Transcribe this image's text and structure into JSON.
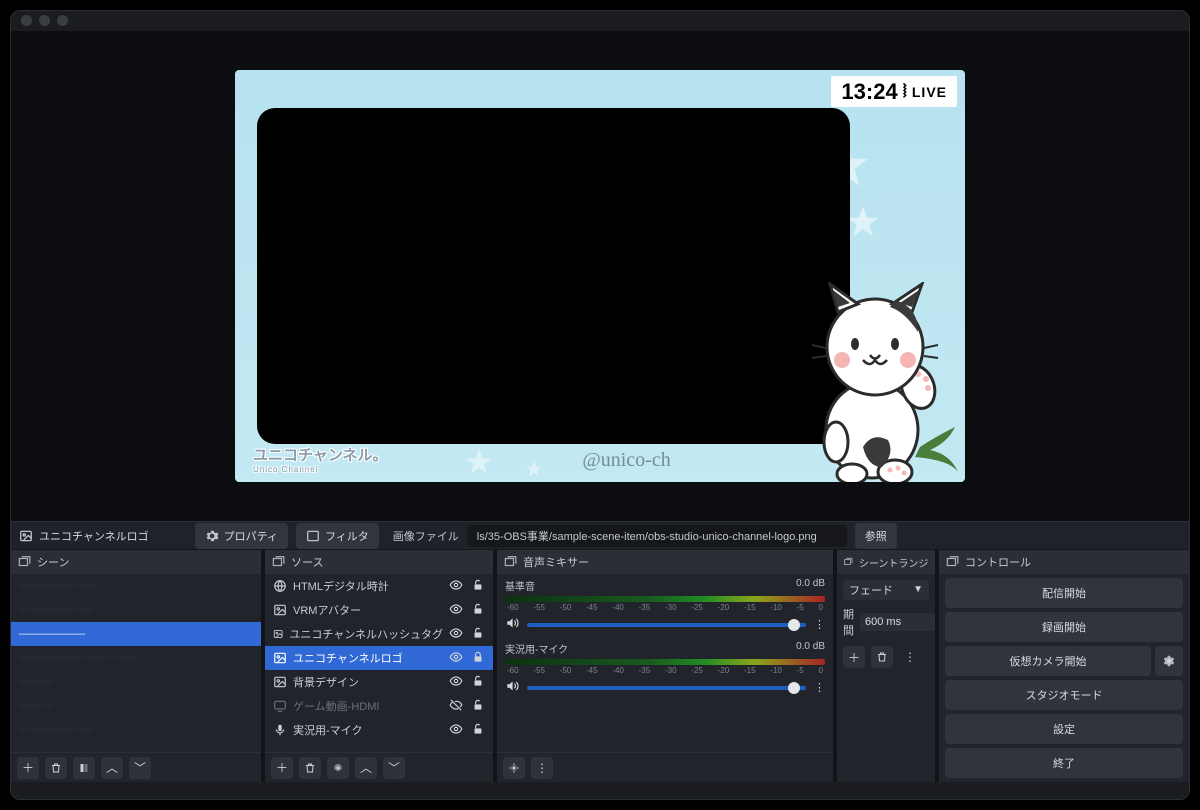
{
  "titlebar": {
    "title": ""
  },
  "toolbar": {
    "selected_source": "ユニコチャンネルロゴ",
    "properties": "プロパティ",
    "filters": "フィルタ",
    "file_label": "画像ファイル",
    "file_path": "ls/35-OBS事業/sample-scene-item/obs-studio-unico-channel-logo.png",
    "browse": "参照"
  },
  "preview": {
    "clock": "13:24",
    "live": "LIVE",
    "logo_line1": "ユニコチャンネル。",
    "logo_line2": "Unico Channel",
    "handle": "@unico-ch"
  },
  "docks": {
    "scenes": {
      "title": "シーン",
      "items": [
        {
          "label": "————— –––",
          "selected": false
        },
        {
          "label": "– ———— –––",
          "selected": false
        },
        {
          "label": "——————",
          "selected": true
        },
        {
          "label": "—————— ––– – –––",
          "selected": false
        },
        {
          "label": "–– –––",
          "selected": false
        },
        {
          "label": "–––– –",
          "selected": false
        },
        {
          "label": "– ———— –––",
          "selected": false
        }
      ]
    },
    "sources": {
      "title": "ソース",
      "items": [
        {
          "icon": "globe",
          "label": "HTMLデジタル時計",
          "vis": true,
          "lock": false,
          "sel": false,
          "dim": false
        },
        {
          "icon": "image",
          "label": "VRMアバター",
          "vis": true,
          "lock": false,
          "sel": false,
          "dim": false
        },
        {
          "icon": "image",
          "label": "ユニコチャンネルハッシュタグ",
          "vis": true,
          "lock": false,
          "sel": false,
          "dim": false
        },
        {
          "icon": "image",
          "label": "ユニコチャンネルロゴ",
          "vis": true,
          "lock": true,
          "sel": true,
          "dim": false
        },
        {
          "icon": "image",
          "label": "背景デザイン",
          "vis": true,
          "lock": false,
          "sel": false,
          "dim": false
        },
        {
          "icon": "display",
          "label": "ゲーム動画-HDMI",
          "vis": false,
          "lock": false,
          "sel": false,
          "dim": true
        },
        {
          "icon": "mic",
          "label": "実況用-マイク",
          "vis": true,
          "lock": false,
          "sel": false,
          "dim": false
        }
      ]
    },
    "mixer": {
      "title": "音声ミキサー",
      "ticks": [
        "-60",
        "-55",
        "-50",
        "-45",
        "-40",
        "-35",
        "-30",
        "-25",
        "-20",
        "-15",
        "-10",
        "-5",
        "0"
      ],
      "channels": [
        {
          "name": "基準音",
          "db": "0.0 dB"
        },
        {
          "name": "実況用-マイク",
          "db": "0.0 dB"
        }
      ]
    },
    "transition": {
      "title": "シーントランジション",
      "type": "フェード",
      "duration_label": "期間",
      "duration": "600 ms"
    },
    "controls": {
      "title": "コントロール",
      "buttons": {
        "stream": "配信開始",
        "record": "録画開始",
        "vcam": "仮想カメラ開始",
        "studio": "スタジオモード",
        "settings": "設定",
        "exit": "終了"
      }
    }
  }
}
